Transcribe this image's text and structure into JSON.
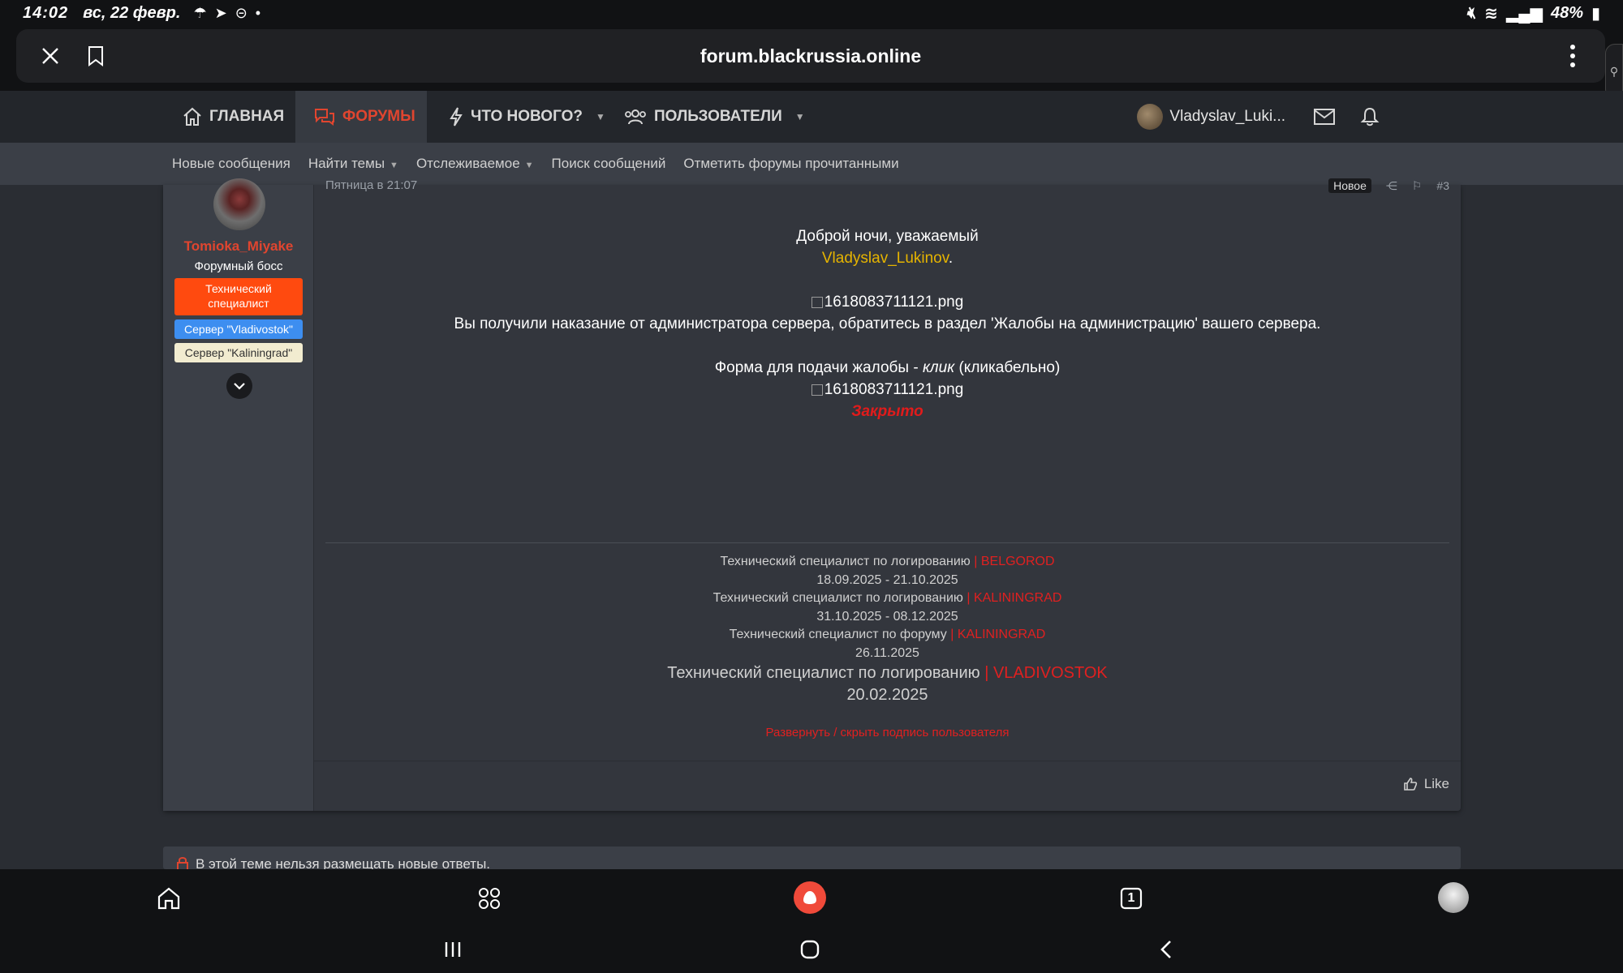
{
  "status_bar": {
    "time": "14:02",
    "date": "вс, 22 февр.",
    "battery": "48%"
  },
  "browser": {
    "url": "forum.blackrussia.online"
  },
  "nav": {
    "home": "ГЛАВНАЯ",
    "forums": "ФОРУМЫ",
    "whats_new": "ЧТО НОВОГО?",
    "users": "ПОЛЬЗОВАТЕЛИ",
    "username": "Vladyslav_Luki..."
  },
  "subnav": {
    "new_messages": "Новые сообщения",
    "find_threads": "Найти темы",
    "watched": "Отслеживаемое",
    "search": "Поиск сообщений",
    "mark_read": "Отметить форумы прочитанными"
  },
  "post": {
    "author": "Tomioka_Miyake",
    "author_title": "Форумный босс",
    "badge_tech": "Технический специалист",
    "badge_vladivostok": "Сервер \"Vladivostok\"",
    "badge_kaliningrad": "Сервер \"Kaliningrad\"",
    "date": "Пятница в 21:07",
    "new_label": "Новое",
    "number": "#3",
    "greeting": "Доброй ночи, уважаемый",
    "mention": "Vladyslav_Lukinov",
    "mention_suffix": ".",
    "image_alt_1": "1618083711121.png",
    "message": "Вы получили наказание от администратора сервера, обратитесь в раздел 'Жалобы на администрацию' вашего сервера.",
    "form_prefix": "Форма для подачи жалобы - ",
    "form_link": "клик",
    "form_suffix": " (кликабельно)",
    "image_alt_2": "1618083711121.png",
    "closed": "Закрыто",
    "like": "Like"
  },
  "signature": {
    "lines": [
      {
        "text": "Технический специалист по логированию",
        "accent": " | BELGOROD",
        "dates": "18.09.2025 - 21.10.2025"
      },
      {
        "text": "Технический специалист по логированию",
        "accent": " | KALININGRAD",
        "dates": "31.10.2025 - 08.12.2025"
      },
      {
        "text": "Технический специалист по форуму",
        "accent": " | KALININGRAD",
        "dates": "26.11.2025"
      },
      {
        "text": "Технический специалист по логированию",
        "accent": " | VLADIVOSTOK",
        "dates": "20.02.2025"
      }
    ],
    "toggle": "Развернуть / скрыть подпись пользователя"
  },
  "locked_notice": "В этой теме нельзя размещать новые ответы.",
  "tabs_count": "1",
  "colors": {
    "accent": "#e0452f",
    "mention": "#e6b400",
    "closed": "#e11b1b"
  }
}
